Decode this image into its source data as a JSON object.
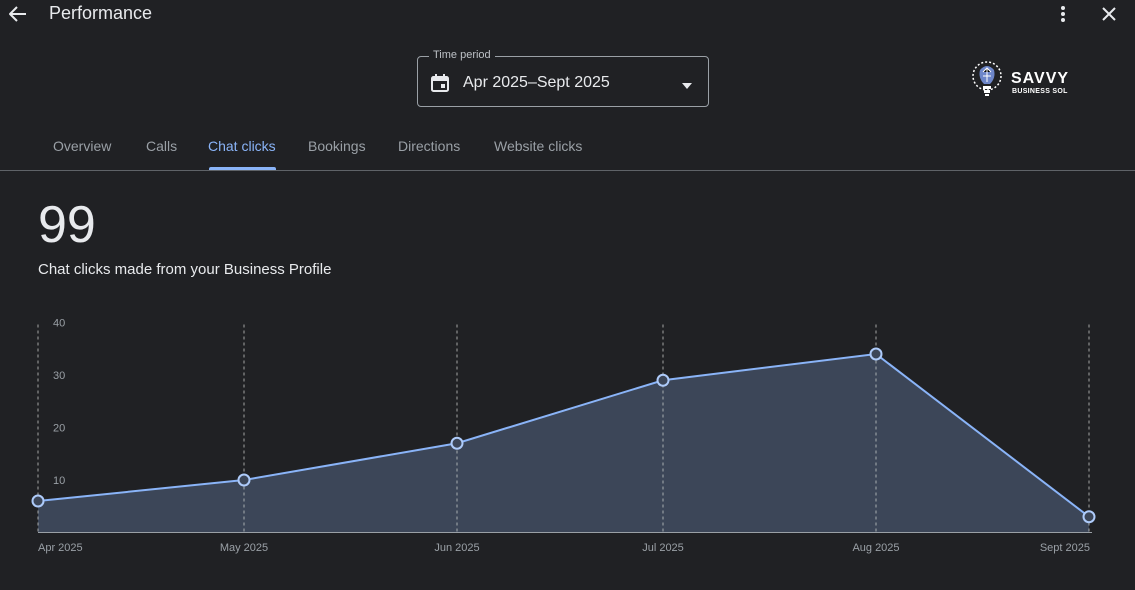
{
  "header": {
    "title": "Performance",
    "back_icon": "arrow-back-icon",
    "more_icon": "more-vert-icon",
    "close_icon": "close-icon"
  },
  "period": {
    "label": "Time period",
    "value": "Apr 2025–Sept 2025",
    "icon": "calendar-icon"
  },
  "logo": {
    "name": "SAVVY",
    "sub": "BUSINESS SOL"
  },
  "tabs": [
    {
      "label": "Overview",
      "active": false
    },
    {
      "label": "Calls",
      "active": false
    },
    {
      "label": "Chat clicks",
      "active": true
    },
    {
      "label": "Bookings",
      "active": false
    },
    {
      "label": "Directions",
      "active": false
    },
    {
      "label": "Website clicks",
      "active": false
    }
  ],
  "metric": {
    "value": "99",
    "description": "Chat clicks made from your Business Profile"
  },
  "colors": {
    "background": "#202124",
    "accent": "#8ab4f8",
    "area_fill": "#3c4658",
    "line": "#8ab4f8"
  },
  "chart_data": {
    "type": "area",
    "x": [
      "Apr 2025",
      "May 2025",
      "Jun 2025",
      "Jul 2025",
      "Aug 2025",
      "Sept 2025"
    ],
    "series": [
      {
        "values": [
          6,
          10,
          17,
          29,
          34,
          3
        ]
      }
    ],
    "yticks": [
      10,
      20,
      30,
      40
    ],
    "ylim": [
      0,
      40
    ],
    "xlabel": "",
    "ylabel": "",
    "grid": "vertical-dashed"
  }
}
